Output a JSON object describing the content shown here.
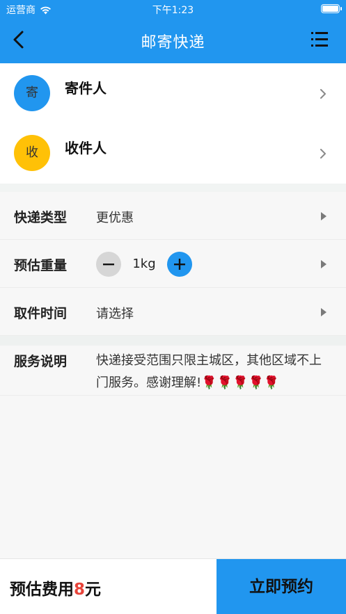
{
  "status": {
    "carrier": "运营商",
    "time": "下午1:23"
  },
  "nav": {
    "title": "邮寄快递"
  },
  "contacts": [
    {
      "badge": "寄",
      "label": "寄件人",
      "color": "#2196ef"
    },
    {
      "badge": "收",
      "label": "收件人",
      "color": "#ffc107"
    }
  ],
  "form": {
    "express_type": {
      "label": "快递类型",
      "value": "更优惠"
    },
    "weight": {
      "label": "预估重量",
      "value": "1kg"
    },
    "pickup_time": {
      "label": "取件时间",
      "value": "请选择"
    }
  },
  "notice": {
    "label": "服务说明",
    "text": "快递接受范围只限主城区，其他区域不上门服务。感谢理解!🌹🌹🌹🌹🌹"
  },
  "footer": {
    "fee_label": "预估费用",
    "fee_amount": "8",
    "fee_unit": "元",
    "book_label": "立即预约"
  },
  "colors": {
    "primary": "#2196ef",
    "accent_red": "#e8443a",
    "receiver_badge": "#ffc107"
  }
}
